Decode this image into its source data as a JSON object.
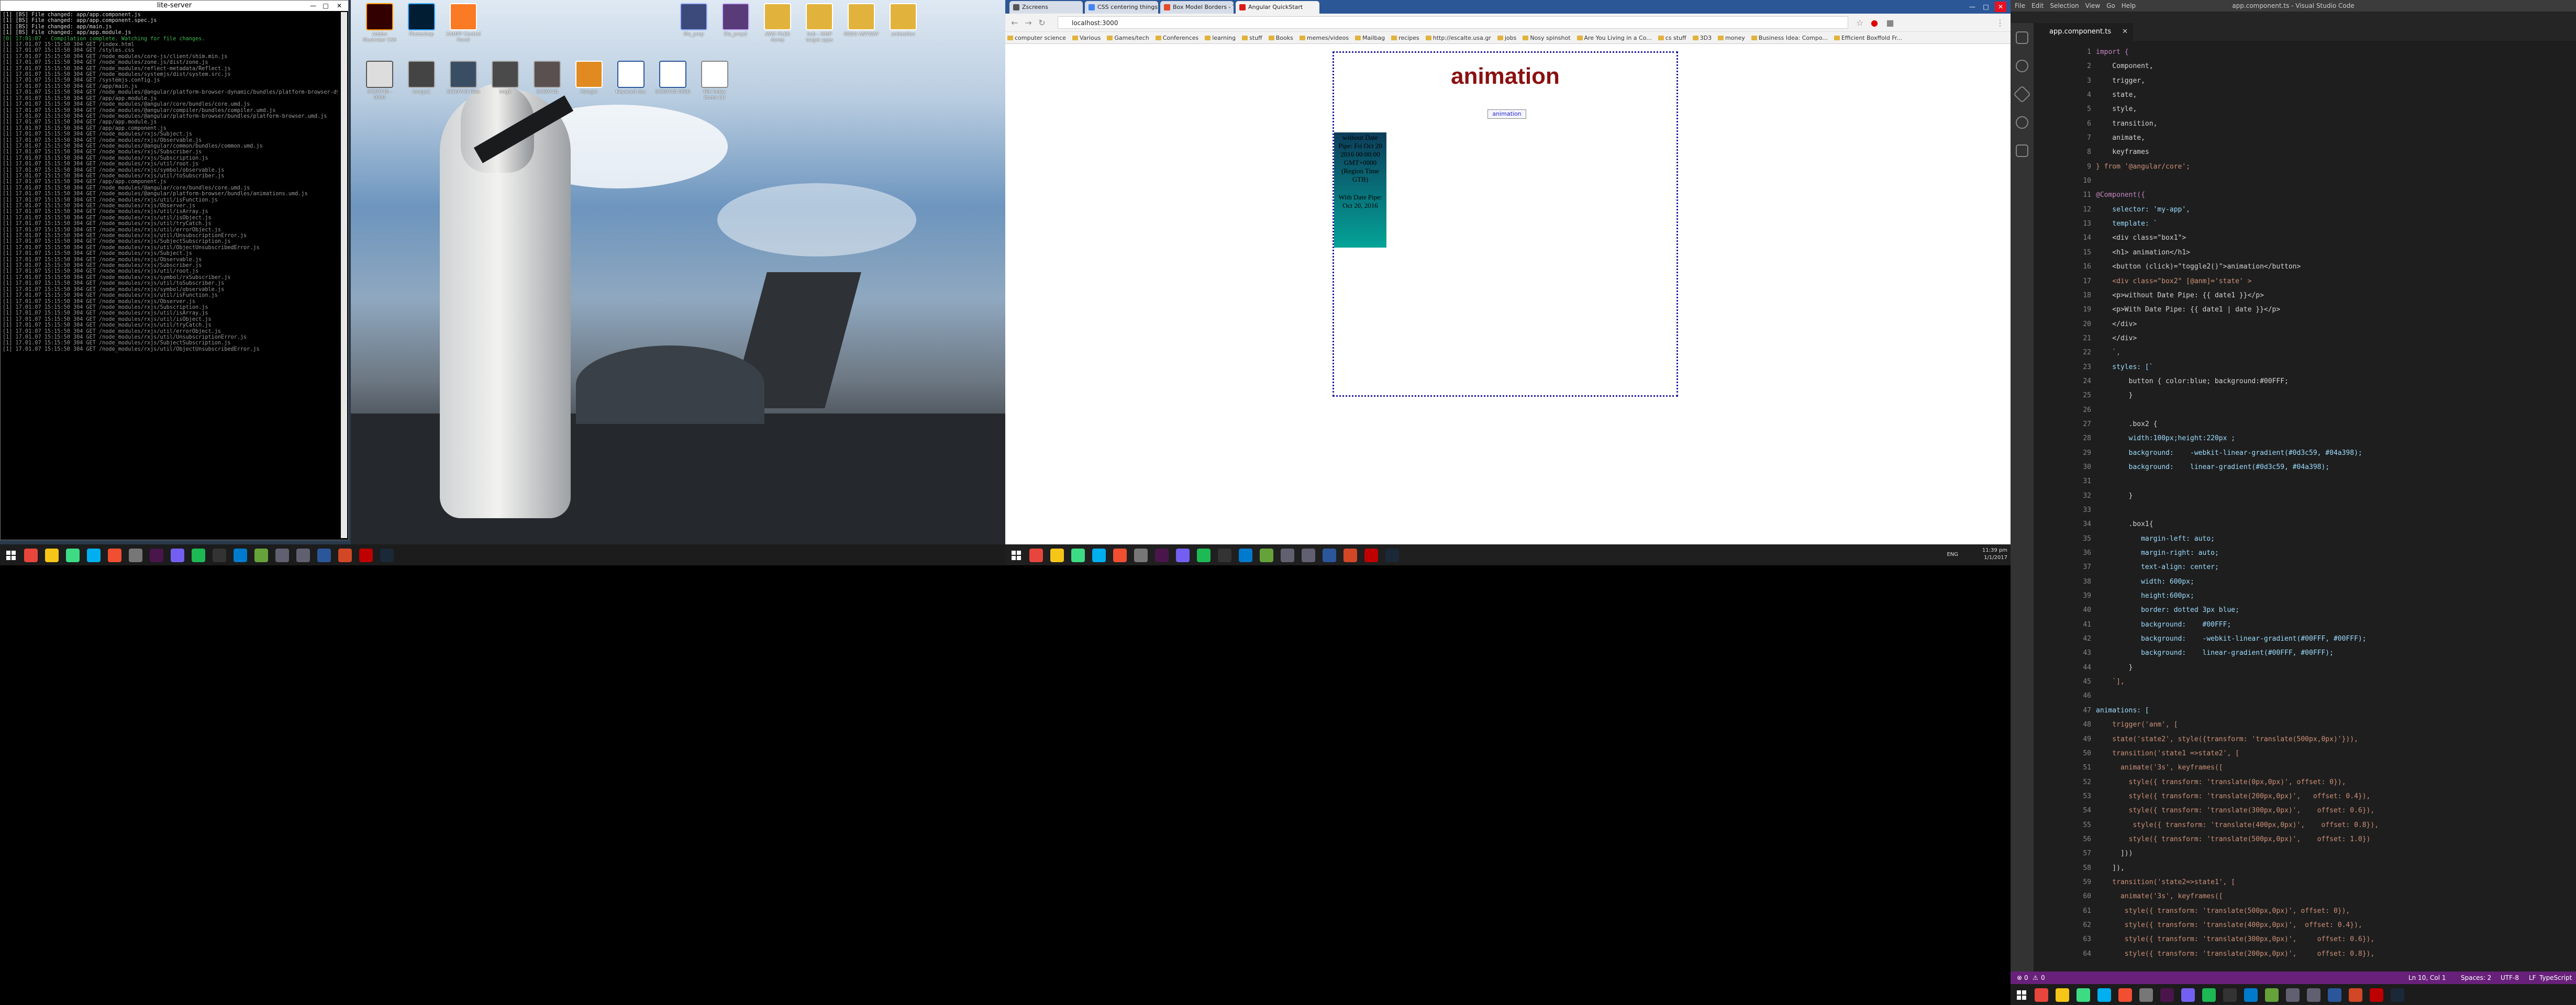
{
  "terminal": {
    "title": "lite-server",
    "lines": [
      "[1] [BS] File changed: app/app.component.js",
      "[1] [BS] File changed: app/app.component.spec.js",
      "[1] [BS] File changed: app/main.js",
      "[1] [BS] File changed: app/app.module.js",
      "[0] 17:01:07 - Compilation complete. Watching for file changes.",
      "[1] 17.01.07 15:15:50 304 GET /index.html",
      "[1] 17.01.07 15:15:50 304 GET /styles.css",
      "[1] 17.01.07 15:15:50 304 GET /node_modules/core-js/client/shim.min.js",
      "[1] 17.01.07 15:15:50 304 GET /node_modules/zone.js/dist/zone.js",
      "[1] 17.01.07 15:15:50 304 GET /node_modules/reflect-metadata/Reflect.js",
      "[1] 17.01.07 15:15:50 304 GET /node_modules/systemjs/dist/system.src.js",
      "[1] 17.01.07 15:15:50 304 GET /systemjs.config.js",
      "[1] 17.01.07 15:15:50 304 GET /app/main.js",
      "[1] 17.01.07 15:15:50 304 GET /node_modules/@angular/platform-browser-dynamic/bundles/platform-browser-dynamic.umd.js",
      "[1] 17.01.07 15:15:50 304 GET /app/app.module.js",
      "[1] 17.01.07 15:15:50 304 GET /node_modules/@angular/core/bundles/core.umd.js",
      "[1] 17.01.07 15:15:50 304 GET /node_modules/@angular/compiler/bundles/compiler.umd.js",
      "[1] 17.01.07 15:15:50 304 GET /node_modules/@angular/platform-browser/bundles/platform-browser.umd.js",
      "[1] 17.01.07 15:15:50 304 GET /app/app.module.js",
      "[1] 17.01.07 15:15:50 304 GET /app/app.component.js",
      "[1] 17.01.07 15:15:50 304 GET /node_modules/rxjs/Subject.js",
      "[1] 17.01.07 15:15:50 304 GET /node_modules/rxjs/Observable.js",
      "[1] 17.01.07 15:15:50 304 GET /node_modules/@angular/common/bundles/common.umd.js",
      "[1] 17.01.07 15:15:50 304 GET /node_modules/rxjs/Subscriber.js",
      "[1] 17.01.07 15:15:50 304 GET /node_modules/rxjs/Subscription.js",
      "[1] 17.01.07 15:15:50 304 GET /node_modules/rxjs/util/root.js",
      "[1] 17.01.07 15:15:50 304 GET /node_modules/rxjs/symbol/observable.js",
      "[1] 17.01.07 15:15:50 304 GET /node_modules/rxjs/util/toSubscriber.js",
      "[1] 17.01.07 15:15:50 304 GET /app/app.component.js",
      "[1] 17.01.07 15:15:50 304 GET /node_modules/@angular/core/bundles/core.umd.js",
      "[1] 17.01.07 15:15:50 304 GET /node_modules/@angular/platform-browser/bundles/animations.umd.js",
      "[1] 17.01.07 15:15:50 304 GET /node_modules/rxjs/util/isFunction.js",
      "[1] 17.01.07 15:15:50 304 GET /node_modules/rxjs/Observer.js",
      "[1] 17.01.07 15:15:50 304 GET /node_modules/rxjs/util/isArray.js",
      "[1] 17.01.07 15:15:50 304 GET /node_modules/rxjs/util/isObject.js",
      "[1] 17.01.07 15:15:50 304 GET /node_modules/rxjs/util/tryCatch.js",
      "[1] 17.01.07 15:15:50 304 GET /node_modules/rxjs/util/errorObject.js",
      "[1] 17.01.07 15:15:50 304 GET /node_modules/rxjs/util/UnsubscriptionError.js",
      "[1] 17.01.07 15:15:50 304 GET /node_modules/rxjs/SubjectSubscription.js",
      "[1] 17.01.07 15:15:50 304 GET /node_modules/rxjs/util/ObjectUnsubscribedError.js",
      "[1] 17.01.07 15:15:50 304 GET /node_modules/rxjs/Subject.js",
      "[1] 17.01.07 15:15:50 304 GET /node_modules/rxjs/Observable.js",
      "[1] 17.01.07 15:15:50 304 GET /node_modules/rxjs/Subscriber.js",
      "[1] 17.01.07 15:15:50 304 GET /node_modules/rxjs/util/root.js",
      "[1] 17.01.07 15:15:50 304 GET /node_modules/rxjs/symbol/rxSubscriber.js",
      "[1] 17.01.07 15:15:50 304 GET /node_modules/rxjs/util/toSubscriber.js",
      "[1] 17.01.07 15:15:50 304 GET /node_modules/rxjs/symbol/observable.js",
      "[1] 17.01.07 15:15:50 304 GET /node_modules/rxjs/util/isFunction.js",
      "[1] 17.01.07 15:15:50 304 GET /node_modules/rxjs/Observer.js",
      "[1] 17.01.07 15:15:50 304 GET /node_modules/rxjs/Subscription.js",
      "[1] 17.01.07 15:15:50 304 GET /node_modules/rxjs/util/isArray.js",
      "[1] 17.01.07 15:15:50 304 GET /node_modules/rxjs/util/isObject.js",
      "[1] 17.01.07 15:15:50 304 GET /node_modules/rxjs/util/tryCatch.js",
      "[1] 17.01.07 15:15:50 304 GET /node_modules/rxjs/util/errorObject.js",
      "[1] 17.01.07 15:15:50 304 GET /node_modules/rxjs/util/UnsubscriptionError.js",
      "[1] 17.01.07 15:15:50 304 GET /node_modules/rxjs/SubjectSubscription.js",
      "[1] 17.01.07 15:15:50 304 GET /node_modules/rxjs/util/ObjectUnsubscribedError.js"
    ]
  },
  "desktop_icons": [
    {
      "label": "Adobe Illustrator CS6",
      "color": "#330000",
      "accent": "#ff9a00"
    },
    {
      "label": "Photoshop",
      "color": "#001d34",
      "accent": "#31a8ff"
    },
    {
      "label": "XAMPP Control Panel",
      "color": "#fb7a24",
      "accent": "#ffffff"
    },
    {
      "label": "file_prep",
      "color": "#3b4a7a",
      "accent": "#9db3ff"
    },
    {
      "label": "file_prep2",
      "color": "#5a3b7a",
      "accent": "#ccb3ff"
    },
    {
      "label": "AWS FILES dump",
      "color": "#e2b33c",
      "accent": "#ffffff"
    },
    {
      "label": "Sub - IMSP target apps",
      "color": "#e2b33c",
      "accent": "#ffffff"
    },
    {
      "label": "REDO ANYWAY",
      "color": "#e2b33c",
      "accent": "#ffffff"
    },
    {
      "label": "animation",
      "color": "#e2b33c",
      "accent": "#ffffff"
    },
    {
      "label": "SCR9748 - ORIG",
      "color": "#dddddd",
      "accent": "#555555"
    },
    {
      "label": "image1",
      "color": "#444444",
      "accent": "#aaaaaa"
    },
    {
      "label": "SCR9748 Files",
      "color": "#3a4e63",
      "accent": "#aaaaaa"
    },
    {
      "label": "img2",
      "color": "#4a4a4a",
      "accent": "#aaaaaa"
    },
    {
      "label": "SCR9748",
      "color": "#5a5050",
      "accent": "#aaaaaa"
    },
    {
      "label": "Hanger",
      "color": "#e08a20",
      "accent": "#ffffff"
    },
    {
      "label": "Keyword doc",
      "color": "#ffffff",
      "accent": "#2b579a"
    },
    {
      "label": "SCR9748 ORIG",
      "color": "#ffffff",
      "accent": "#2b579a"
    },
    {
      "label": "File index Items (1)",
      "color": "#ffffff",
      "accent": "#888888"
    }
  ],
  "browser": {
    "tabs": [
      {
        "label": "Zscreens",
        "favicon_color": "#555555"
      },
      {
        "label": "CSS centering things",
        "favicon_color": "#4285f4"
      },
      {
        "label": "Box Model Borders - The",
        "favicon_color": "#e34c26"
      },
      {
        "label": "Angular QuickStart",
        "favicon_color": "#dd1b16"
      }
    ],
    "url": "localhost:3000",
    "bookmarks": [
      "computer science",
      "Various",
      "Games/tech",
      "Conferences",
      "learning",
      "stuff",
      "Books",
      "memes/videos",
      "Mailbag",
      "recipes",
      "http://escalte.usa.gr",
      "jobs",
      "Nosy spinshot",
      "Are You Living in a Co...",
      "cs stuff",
      "3D3",
      "money",
      "Business Idea: Compo...",
      "Efficient Boxffold Fr..."
    ]
  },
  "app_page": {
    "heading": "animation",
    "button_label": "animation",
    "without_date_pipe": "without Date Pipe: Fri Oct 20 2016 00:00:00 GMT+0000 (Region Time GTB)",
    "with_date_pipe": "With Date Pipe: Oct 20, 2016"
  },
  "taskbar1": {
    "time": "11:39 pm",
    "date": "1/1/2017",
    "lang": "ENG"
  },
  "vscode": {
    "window_title": "app.component.ts - Visual Studio Code",
    "menu": [
      "File",
      "Edit",
      "Selection",
      "View",
      "Go",
      "Help"
    ],
    "tab_label": "app.component.ts",
    "status": {
      "errors": "0",
      "warnings": "0",
      "position": "Ln 10, Col 1",
      "spaces": "Spaces: 2",
      "encoding": "UTF-8",
      "eol": "LF",
      "language": "TypeScript"
    },
    "code_lines": [
      "import {",
      "    Component,",
      "    trigger,",
      "    state,",
      "    style,",
      "    transition,",
      "    animate,",
      "    keyframes",
      "} from '@angular/core';",
      "",
      "@Component({",
      "    selector: 'my-app',",
      "    template: `",
      "    <div class=\"box1\">",
      "    <h1> animation</h1>",
      "    <button (click)=\"toggle2()\">animation</button>",
      "    <div class=\"box2\" [@anm]='state' >",
      "    <p>without Date Pipe: {{ date1 }}</p>",
      "    <p>With Date Pipe: {{ date1 | date }}</p>",
      "    </div>",
      "    </div>",
      "    `,",
      "    styles: [`",
      "        button { color:blue; background:#00FFF;",
      "        }",
      "",
      "        .box2 {",
      "        width:100px;height:220px ;",
      "        background:    -webkit-linear-gradient(#0d3c59, #04a398);",
      "        background:    linear-gradient(#0d3c59, #04a398);",
      "",
      "        }",
      "",
      "        .box1{",
      "           margin-left: auto;",
      "           margin-right: auto;",
      "           text-align: center;",
      "           width: 600px;",
      "           height:600px;",
      "           border: dotted 3px blue;",
      "           background:    #00FFF;",
      "           background:    -webkit-linear-gradient(#00FFF, #00FFF);",
      "           background:    linear-gradient(#00FFF, #00FFF);",
      "        }",
      "    `],",
      "",
      "animations: [",
      "    trigger('anm', [",
      "    state('state2', style({transform: 'translate(500px,0px)'})),",
      "    transition('state1 =>state2', [",
      "      animate('3s', keyframes([",
      "        style({ transform: 'translate(0px,0px)', offset: 0}),",
      "        style({ transform: 'translate(200px,0px)',   offset: 0.4}),",
      "        style({ transform: 'translate(300px,0px)',    offset: 0.6}),",
      "         style({ transform: 'translate(400px,0px)',    offset: 0.8}),",
      "        style({ transform: 'translate(500px,0px)',    offset: 1.0})",
      "      ]))",
      "    ]),",
      "    transition('state2=>state1', [",
      "      animate('3s', keyframes([",
      "       style({ transform: 'translate(500px,0px)', offset: 0}),",
      "       style({ transform: 'translate(400px,0px)',  offset: 0.4}),",
      "       style({ transform: 'translate(300px,0px)',     offset: 0.6}),",
      "       style({ transform: 'translate(200px,0px)',     offset: 0.8}),"
    ]
  },
  "taskbar_apps": [
    {
      "name": "chrome-icon",
      "color": "#e8453c"
    },
    {
      "name": "explorer-icon",
      "color": "#f5c518"
    },
    {
      "name": "android-studio-icon",
      "color": "#3ddc84"
    },
    {
      "name": "skype-icon",
      "color": "#00aff0"
    },
    {
      "name": "git-icon",
      "color": "#f14e32"
    },
    {
      "name": "vm-icon",
      "color": "#777777"
    },
    {
      "name": "slack-icon",
      "color": "#4a154b"
    },
    {
      "name": "viber-icon",
      "color": "#7360f2"
    },
    {
      "name": "spotify-icon",
      "color": "#1db954"
    },
    {
      "name": "terminal-icon",
      "color": "#333333"
    },
    {
      "name": "vscode-icon",
      "color": "#007acc"
    },
    {
      "name": "notepad-icon",
      "color": "#65a33a"
    },
    {
      "name": "media-icon",
      "color": "#606070"
    },
    {
      "name": "media2-icon",
      "color": "#606070"
    },
    {
      "name": "word-icon",
      "color": "#2b579a"
    },
    {
      "name": "powerpoint-icon",
      "color": "#d24726"
    },
    {
      "name": "filezilla-icon",
      "color": "#bf0000"
    },
    {
      "name": "steam-icon",
      "color": "#1b2838"
    }
  ]
}
